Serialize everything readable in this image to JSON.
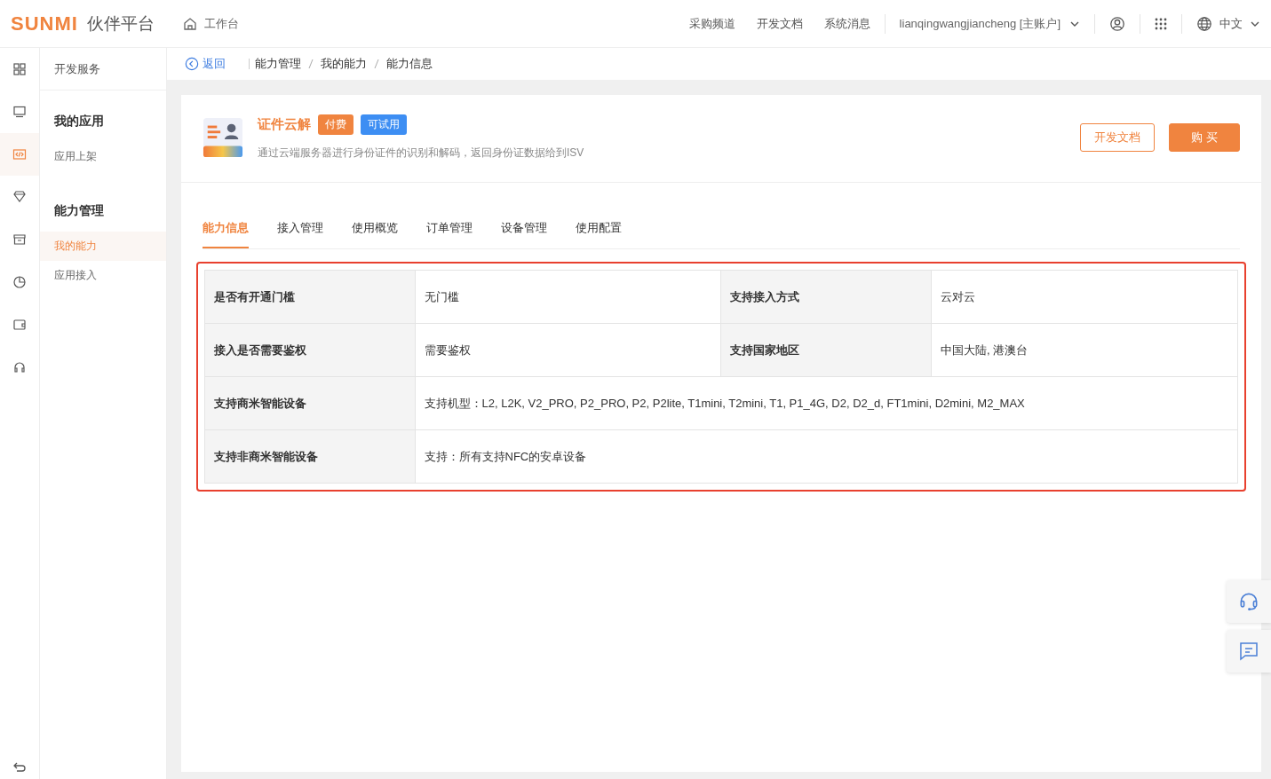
{
  "header": {
    "logo": "SUNMI",
    "platform": "伙伴平台",
    "home": "工作台",
    "nav": [
      "采购频道",
      "开发文档",
      "系统消息"
    ],
    "account": "lianqingwangjiancheng [主账户]",
    "language": "中文"
  },
  "rail": {
    "items": [
      {
        "selected": false
      },
      {
        "selected": false
      },
      {
        "selected": true
      },
      {
        "selected": false
      },
      {
        "selected": false
      },
      {
        "selected": false
      },
      {
        "selected": false
      },
      {
        "selected": false
      }
    ]
  },
  "sidebar": {
    "title": "开发服务",
    "groups": [
      {
        "title": "我的应用",
        "items": [
          {
            "label": "应用上架",
            "selected": false
          }
        ]
      },
      {
        "title": "能力管理",
        "items": [
          {
            "label": "我的能力",
            "selected": true
          },
          {
            "label": "应用接入",
            "selected": false
          }
        ]
      }
    ]
  },
  "breadcrumb": {
    "back": "返回",
    "items": [
      "能力管理",
      "我的能力",
      "能力信息"
    ]
  },
  "product": {
    "name": "证件云解",
    "tags": [
      {
        "label": "付费",
        "color": "#f0843f"
      },
      {
        "label": "可试用",
        "color": "#3d8ef3"
      }
    ],
    "description": "通过云端服务器进行身份证件的识别和解码，返回身份证数据给到ISV",
    "buttons": [
      {
        "label": "开发文档",
        "kind": "outline"
      },
      {
        "label": "购 买",
        "kind": "primary"
      }
    ]
  },
  "tabs": [
    {
      "label": "能力信息",
      "selected": true
    },
    {
      "label": "接入管理",
      "selected": false
    },
    {
      "label": "使用概览",
      "selected": false
    },
    {
      "label": "订单管理",
      "selected": false
    },
    {
      "label": "设备管理",
      "selected": false
    },
    {
      "label": "使用配置",
      "selected": false
    }
  ],
  "info_table": {
    "rows": [
      {
        "cells": [
          {
            "label": "是否有开通门槛",
            "value": "无门槛"
          },
          {
            "label": "支持接入方式",
            "value": "云对云"
          }
        ]
      },
      {
        "cells": [
          {
            "label": "接入是否需要鉴权",
            "value": "需要鉴权"
          },
          {
            "label": "支持国家地区",
            "value": "中国大陆, 港澳台"
          }
        ]
      },
      {
        "cells": [
          {
            "label": "支持商米智能设备",
            "value": "支持机型：L2, L2K, V2_PRO, P2_PRO, P2, P2lite, T1mini, T2mini, T1, P1_4G, D2, D2_d, FT1mini, D2mini, M2_MAX"
          }
        ]
      },
      {
        "cells": [
          {
            "label": "支持非商米智能设备",
            "value": "支持：所有支持NFC的安卓设备"
          }
        ]
      }
    ]
  }
}
